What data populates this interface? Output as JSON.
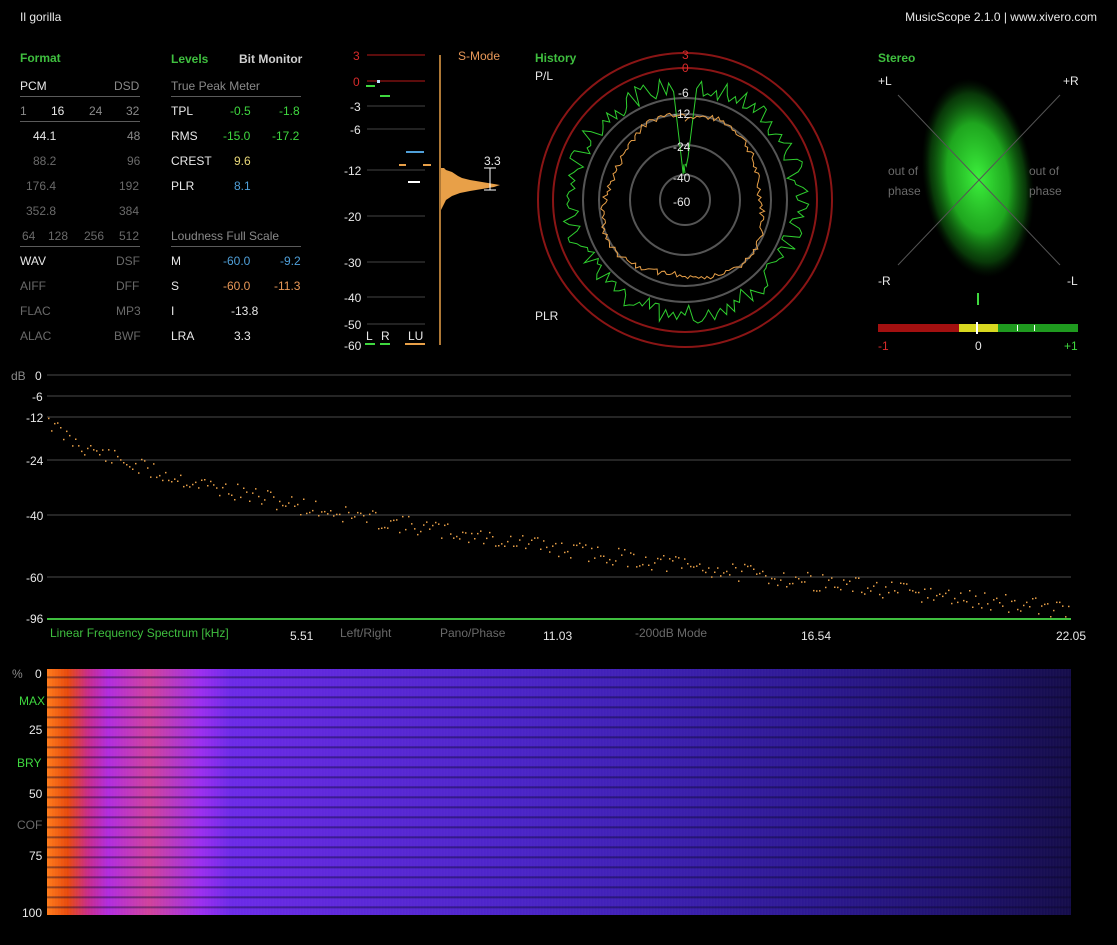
{
  "titlebar": {
    "track": "Il gorilla",
    "app": "MusicScope 2.1.0 | www.xivero.com"
  },
  "format": {
    "header": "Format",
    "pcm": "PCM",
    "dsd": "DSD",
    "bit_depths": [
      "1",
      "16",
      "24",
      "32"
    ],
    "rates_left": [
      "44.1",
      "88.2",
      "176.4",
      "352.8"
    ],
    "rates_right": [
      "48",
      "96",
      "192",
      "384"
    ],
    "dsd_rates": [
      "64",
      "128",
      "256",
      "512"
    ],
    "containers": [
      [
        "WAV",
        "DSF"
      ],
      [
        "AIFF",
        "DFF"
      ],
      [
        "FLAC",
        "MP3"
      ],
      [
        "ALAC",
        "BWF"
      ]
    ]
  },
  "levels": {
    "header": "Levels",
    "bit_monitor": "Bit Monitor",
    "true_peak_title": "True Peak Meter",
    "rows": [
      {
        "label": "TPL",
        "l": "-0.5",
        "r": "-1.8"
      },
      {
        "label": "RMS",
        "l": "-15.0",
        "r": "-17.2"
      },
      {
        "label": "CREST",
        "l": "9.6",
        "r": ""
      },
      {
        "label": "PLR",
        "l": "8.1",
        "r": ""
      }
    ],
    "loudness_title": "Loudness Full Scale",
    "loudness": [
      {
        "label": "M",
        "a": "-60.0",
        "b": "-9.2"
      },
      {
        "label": "S",
        "a": "-60.0",
        "b": "-11.3"
      },
      {
        "label": "I",
        "a": "-13.8",
        "b": ""
      },
      {
        "label": "LRA",
        "a": "3.3",
        "b": ""
      }
    ]
  },
  "meter": {
    "scale": [
      "3",
      "0",
      "-3",
      "-6",
      "-12",
      "-20",
      "-30",
      "-40",
      "-50",
      "-60"
    ],
    "smode": "S-Mode",
    "lra_value": "3.3",
    "channels": [
      "L",
      "R",
      "LU"
    ]
  },
  "history": {
    "header": "History",
    "pl": "P/L",
    "plr": "PLR",
    "rings": [
      "3",
      "0",
      "-6",
      "-12",
      "-24",
      "-40",
      "-60"
    ]
  },
  "stereo": {
    "header": "Stereo",
    "plus_l": "+L",
    "plus_r": "+R",
    "minus_r": "-R",
    "minus_l": "-L",
    "out_of_phase_1": "out of",
    "out_of_phase_2": "phase",
    "correlation_labels": [
      "-1",
      "0",
      "+1"
    ],
    "correlation_value": 0.0
  },
  "spectrum": {
    "db_label": "dB",
    "db_ticks": [
      "0",
      "-6",
      "-12",
      "-24",
      "-40",
      "-60",
      "-96"
    ],
    "mode_label": "Linear Frequency Spectrum [kHz]",
    "x_ticks": [
      "5.51",
      "11.03",
      "16.54",
      "22.05"
    ],
    "buttons": [
      "Left/Right",
      "Pano/Phase",
      "-200dB Mode"
    ]
  },
  "spectrogram": {
    "pct": "%",
    "ticks": [
      "0",
      "25",
      "50",
      "75",
      "100"
    ],
    "markers": [
      "MAX",
      "BRY",
      "COF"
    ]
  },
  "colors": {
    "green": "#3fbf3f",
    "orange": "#e8a048",
    "red": "#b81818",
    "blue": "#4f9fd8",
    "spectrogram_bg": "#1a0d5c"
  }
}
